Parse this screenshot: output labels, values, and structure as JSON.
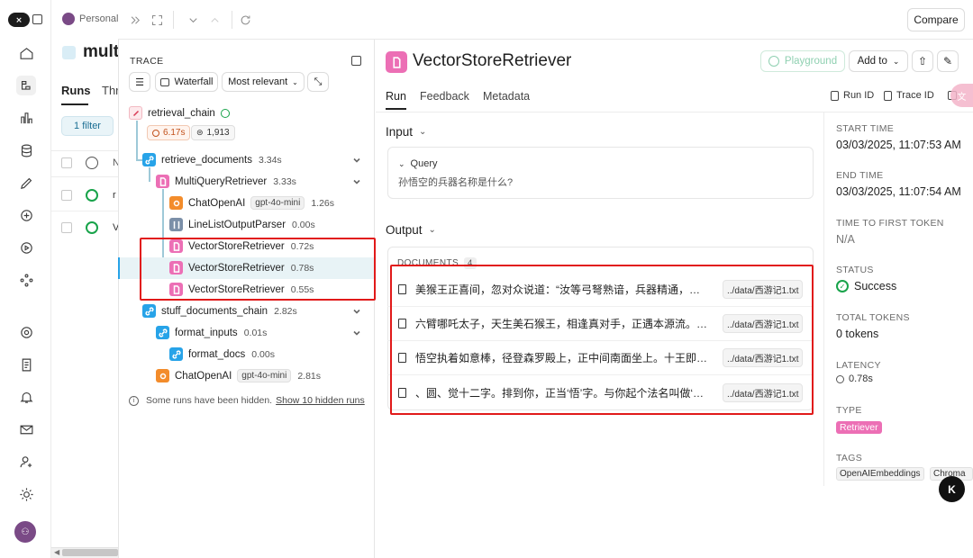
{
  "workspace": {
    "name": "Personal"
  },
  "project": {
    "title": "multi",
    "tabs": [
      "Runs",
      "Thr"
    ],
    "filter_label": "1 filter",
    "col_partial": "N",
    "row1_partial": "r",
    "row2_partial": "V"
  },
  "topbar": {
    "compare_label": "Compare"
  },
  "trace": {
    "header": "TRACE",
    "waterfall_label": "Waterfall",
    "sort_label": "Most relevant",
    "root": {
      "name": "retrieval_chain",
      "latency": "6.17s",
      "tokens": "1,913"
    },
    "nodes": [
      {
        "name": "retrieve_documents",
        "duration": "3.34s"
      },
      {
        "name": "MultiQueryRetriever",
        "duration": "3.33s"
      },
      {
        "name": "ChatOpenAI",
        "model": "gpt-4o-mini",
        "duration": "1.26s"
      },
      {
        "name": "LineListOutputParser",
        "duration": "0.00s"
      },
      {
        "name": "VectorStoreRetriever",
        "duration": "0.72s"
      },
      {
        "name": "VectorStoreRetriever",
        "duration": "0.78s"
      },
      {
        "name": "VectorStoreRetriever",
        "duration": "0.55s"
      },
      {
        "name": "stuff_documents_chain",
        "duration": "2.82s"
      },
      {
        "name": "format_inputs",
        "duration": "0.01s"
      },
      {
        "name": "format_docs",
        "duration": "0.00s"
      },
      {
        "name": "ChatOpenAI",
        "model": "gpt-4o-mini",
        "duration": "2.81s"
      }
    ],
    "hidden_note": "Some runs have been hidden.",
    "hidden_link": "Show 10 hidden runs"
  },
  "run": {
    "title": "VectorStoreRetriever",
    "playground_label": "Playground",
    "add_to_label": "Add to",
    "tabs": [
      "Run",
      "Feedback",
      "Metadata"
    ],
    "run_id_label": "Run ID",
    "trace_id_label": "Trace ID",
    "input_label": "Input",
    "query_label": "Query",
    "query_value": "孙悟空的兵器名称是什么?",
    "output_label": "Output",
    "documents_label": "DOCUMENTS",
    "documents_count": "4",
    "documents": [
      {
        "text": "美猴王正喜间，忽对众说道：“汝等弓弩熟谙，兵器精通，…",
        "source": "../data/西游记1.txt"
      },
      {
        "text": "六臂哪吒太子，天生美石猴王，相逢真对手，正遇本源流。…",
        "source": "../data/西游记1.txt"
      },
      {
        "text": "悟空执着如意棒，径登森罗殿上，正中间南面坐上。十王即…",
        "source": "../data/西游记1.txt"
      },
      {
        "text": "、圆、觉十二字。排到你，正当‘悟’字。与你起个法名叫做‘…",
        "source": "../data/西游记1.txt"
      }
    ]
  },
  "meta": {
    "start_time_label": "START TIME",
    "start_time": "03/03/2025, 11:07:53 AM",
    "end_time_label": "END TIME",
    "end_time": "03/03/2025, 11:07:54 AM",
    "ttft_label": "TIME TO FIRST TOKEN",
    "ttft": "N/A",
    "status_label": "STATUS",
    "status": "Success",
    "total_tokens_label": "TOTAL TOKENS",
    "total_tokens": "0 tokens",
    "latency_label": "LATENCY",
    "latency": "0.78s",
    "type_label": "TYPE",
    "type": "Retriever",
    "tags_label": "TAGS",
    "tags": [
      "OpenAIEmbeddings",
      "Chroma"
    ]
  },
  "colors": {
    "accent_pink": "#ec6fb5",
    "success_green": "#18a34a",
    "highlight_red": "#e11a1a",
    "link_blue": "#27a3e8"
  }
}
